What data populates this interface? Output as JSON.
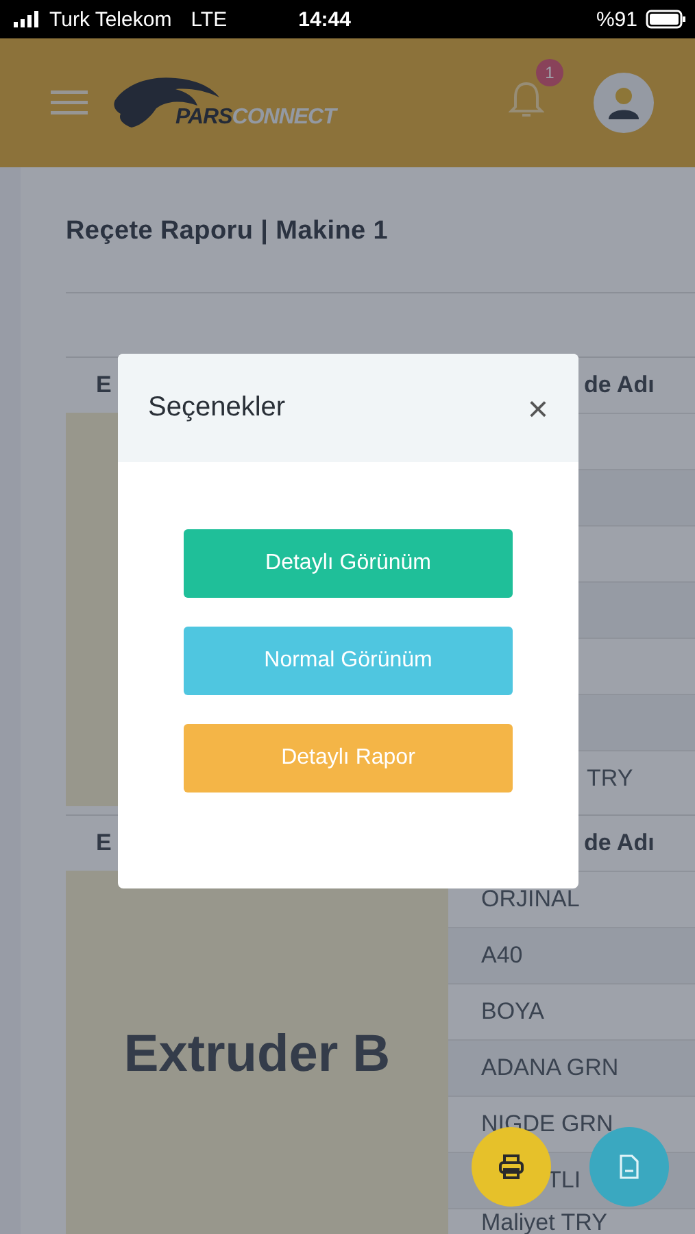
{
  "status_bar": {
    "carrier": "Turk Telekom",
    "network": "LTE",
    "time": "14:44",
    "battery": "%91"
  },
  "header": {
    "logo": {
      "text_dark": "PARS",
      "text_light": "CONNECT"
    },
    "notification_count": "1"
  },
  "page": {
    "title": "Reçete Raporu | Makine 1"
  },
  "tables": [
    {
      "header_left": "E",
      "header_right": "de Adı",
      "rows": [
        "TRY"
      ]
    },
    {
      "header_left": "E",
      "header_right": "de Adı",
      "block_label": "Extruder B",
      "rows": [
        "ORJINAL",
        "A40",
        "BOYA",
        "ADANA GRN",
        "NIGDE GRN",
        "TLI",
        "Maliyet TRY"
      ]
    }
  ],
  "modal": {
    "title": "Seçenekler",
    "close": "×",
    "buttons": [
      {
        "label": "Detaylı Görünüm",
        "color": "#1fbf99"
      },
      {
        "label": "Normal Görünüm",
        "color": "#4fc6e0"
      },
      {
        "label": "Detaylı Rapor",
        "color": "#f4b547"
      }
    ]
  }
}
